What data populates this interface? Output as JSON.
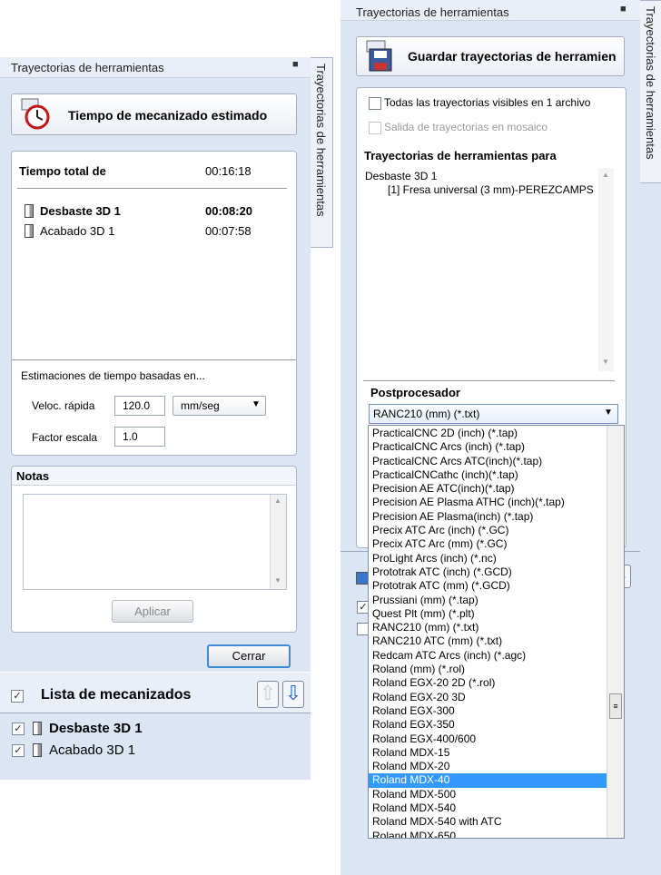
{
  "left": {
    "panel_title": "Trayectorias de herramientas",
    "side_tab": "Trayectorias de herramientas",
    "estimate_button": "Tiempo de mecanizado estimado",
    "total_label": "Tiempo total de",
    "total_time": "00:16:18",
    "rows": [
      {
        "name": "Desbaste 3D 1",
        "time": "00:08:20",
        "bold": true
      },
      {
        "name": "Acabado 3D 1",
        "time": "00:07:58",
        "bold": false
      }
    ],
    "estimates_label": "Estimaciones de tiempo basadas en...",
    "rapid_label": "Veloc. rápida",
    "rapid_value": "120.0",
    "rapid_unit": "mm/seg",
    "scale_label": "Factor escala",
    "scale_value": "1.0",
    "notes_label": "Notas",
    "apply_button": "Aplicar",
    "close_button": "Cerrar",
    "machining_list_label": "Lista de mecanizados",
    "machining_items": [
      {
        "name": "Desbaste 3D 1",
        "bold": true
      },
      {
        "name": "Acabado 3D 1",
        "bold": false
      }
    ]
  },
  "right": {
    "panel_title": "Trayectorias de herramientas",
    "side_tab": "Trayectorias de herramientas",
    "save_button": "Guardar trayectorias de herramien",
    "all_visible_label": "Todas las trayectorias visibles en 1 archivo",
    "tiled_label": "Salida de trayectorias en mosaico",
    "toolpaths_for_label": "Trayectorias de herramientas para",
    "toolpath_group": "Desbaste 3D 1",
    "toolpath_tool": "[1] Fresa universal (3 mm)-PEREZCAMPS",
    "postprocessor_label": "Postprocesador",
    "postprocessor_selected": "RANC210 (mm) (*.txt)",
    "postprocessor_options": [
      "PracticalCNC 2D (inch) (*.tap)",
      "PracticalCNC Arcs (inch) (*.tap)",
      "PracticalCNC Arcs ATC(inch)(*.tap)",
      "PracticalCNCathc (inch)(*.tap)",
      "Precision AE ATC(inch)(*.tap)",
      "Precision AE Plasma ATHC (inch)(*.tap)",
      "Precision AE Plasma(inch) (*.tap)",
      "Precix ATC Arc (inch) (*.GC)",
      "Precix ATC Arc (mm) (*.GC)",
      "ProLight Arcs (inch) (*.nc)",
      "Prototrak ATC (inch) (*.GCD)",
      "Prototrak ATC (mm) (*.GCD)",
      "Prussiani (mm) (*.tap)",
      "Quest Plt (mm) (*.plt)",
      "RANC210 (mm) (*.txt)",
      "RANC210 ATC (mm) (*.txt)",
      "Redcam ATC Arcs (inch) (*.agc)",
      "Roland (mm) (*.rol)",
      "Roland EGX-20 2D (*.rol)",
      "Roland EGX-20 3D",
      "Roland EGX-300",
      "Roland EGX-350",
      "Roland EGX-400/600",
      "Roland MDX-15",
      "Roland MDX-20",
      "Roland MDX-40",
      "Roland MDX-500",
      "Roland MDX-540",
      "Roland MDX-540 with ATC",
      "Roland MDX-650"
    ],
    "highlighted_option": "Roland MDX-40"
  }
}
